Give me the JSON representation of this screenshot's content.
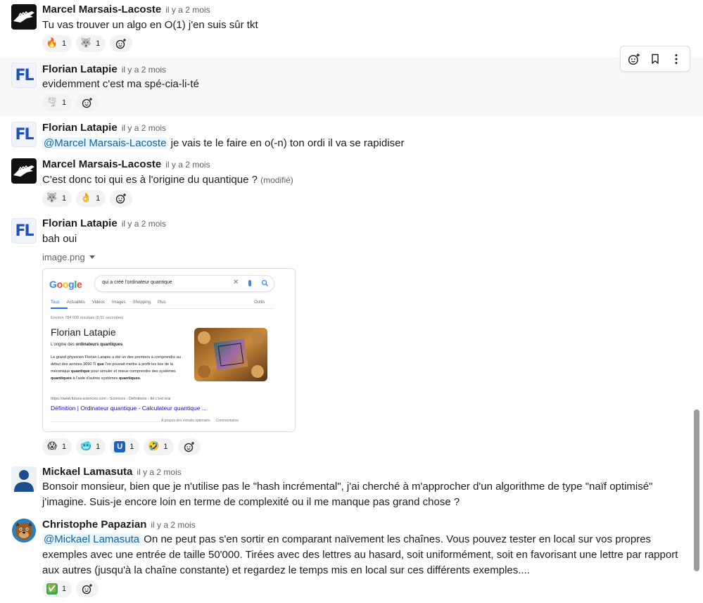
{
  "messages": [
    {
      "author": "Marcel Marsais-Lacoste",
      "time": "il y a 2 mois",
      "text": "Tu vas trouver un algo en O(1) j'en suis sûr tkt",
      "reactions": [
        {
          "emoji": "🔥",
          "icon": "fire-icon",
          "count": "1"
        },
        {
          "emoji": "🐺",
          "icon": "wolf-icon",
          "count": "1"
        }
      ]
    },
    {
      "author": "Florian Latapie",
      "time": "il y a 2 mois",
      "text": "evidemment c'est ma spé-cia-li-té",
      "reactions": [
        {
          "emoji": "🌪",
          "icon": "tornado-icon",
          "count": "1"
        }
      ]
    },
    {
      "author": "Florian Latapie",
      "time": "il y a 2 mois",
      "mention": "@Marcel Marsais-Lacoste",
      "text": " je vais te le faire en o(-n) ton ordi il va se rapidiser"
    },
    {
      "author": "Marcel Marsais-Lacoste",
      "time": "il y a 2 mois",
      "text": "C'est donc toi qui es à l'origine du quantique ? ",
      "edited": "(modifié)",
      "reactions": [
        {
          "emoji": "🐺",
          "icon": "wolf-icon",
          "count": "1"
        },
        {
          "emoji": "👌",
          "icon": "ok-hand-icon",
          "count": "1"
        }
      ]
    },
    {
      "author": "Florian Latapie",
      "time": "il y a 2 mois",
      "text": "bah oui",
      "file_name": "image.png",
      "reactions": [
        {
          "emoji": "😱",
          "icon": "scream-icon",
          "count": "1"
        },
        {
          "emoji": "🥶",
          "icon": "cold-face-icon",
          "count": "1"
        },
        {
          "emoji": "U",
          "icon": "u-badge-icon",
          "count": "1"
        },
        {
          "emoji": "🤣",
          "icon": "rofl-icon",
          "count": "1"
        }
      ]
    },
    {
      "author": "Mickael Lamasuta",
      "time": "il y a 2 mois",
      "text": "Bonsoir monsieur, bien que je n'utilise pas le \"hash incrémental\", j'ai cherché à m'approcher d'un algorithme de type \"naïf optimisé\" j'imagine. Suis-je encore loin en terme de complexité ou il me manque pas grand chose ?"
    },
    {
      "author": "Christophe Papazian",
      "time": "il y a 2 mois",
      "mention": "@Mickael Lamasuta",
      "text": " On ne peut pas s'en sortir en comparant naïvement les chaînes. Vous pouvez tester en local sur vos propres exemples avec une entrée de taille 50'000. Tirées avec des lettres au hasard, soit uniformément, soit en favorisant une lettre par rapport aux autres (jusqu'à la chaîne constante) et regardez le temps mis en local sur ces différents exemples....",
      "reactions": [
        {
          "emoji": "✅",
          "icon": "check-mark-icon",
          "count": "1"
        }
      ]
    }
  ],
  "avatar_initials": "FL",
  "screenshot": {
    "logo": "Google",
    "query": "qui a créé l'ordinateur quantique",
    "tabs": [
      "Tous",
      "Actualités",
      "Vidéos",
      "Images",
      "Shopping",
      "Plus"
    ],
    "tools": "Outils",
    "stats": "Environ 784 000 résultats (0,51 secondes)",
    "title": "Florian Latapie",
    "subtitle_pre": "L'origine des ",
    "subtitle_bold": "ordinateurs quantiques",
    "body_1": "Le grand physicien Florian Latapie a été un des premiers à comprendre au début des années 3090 Ti ",
    "body_que": "que",
    "body_2": " l'on pouvait mettre à profit les lois de la mécanique ",
    "body_quantique": "quantique",
    "body_3": " pour simuler et mieux comprendre des systèmes ",
    "body_quantiques": "quantiques",
    "body_4": " à l'aide d'autres systèmes ",
    "body_quantiques2": "quantiques",
    "body_5": ".",
    "url": "https://www.futura-sciences.com › Sciences › Définitions › tkt c'est vrai",
    "link": "Définition | Ordinateur quantique - Calculateur quantique ...",
    "footer_about": "À propos des extraits optimisés",
    "footer_comments": "Commentaires"
  },
  "colors": {
    "mention_text": "#1264a3",
    "mention_bg": "#e8f5fa",
    "link": "#1a0dab",
    "hover_bg": "#f8f8f8"
  }
}
